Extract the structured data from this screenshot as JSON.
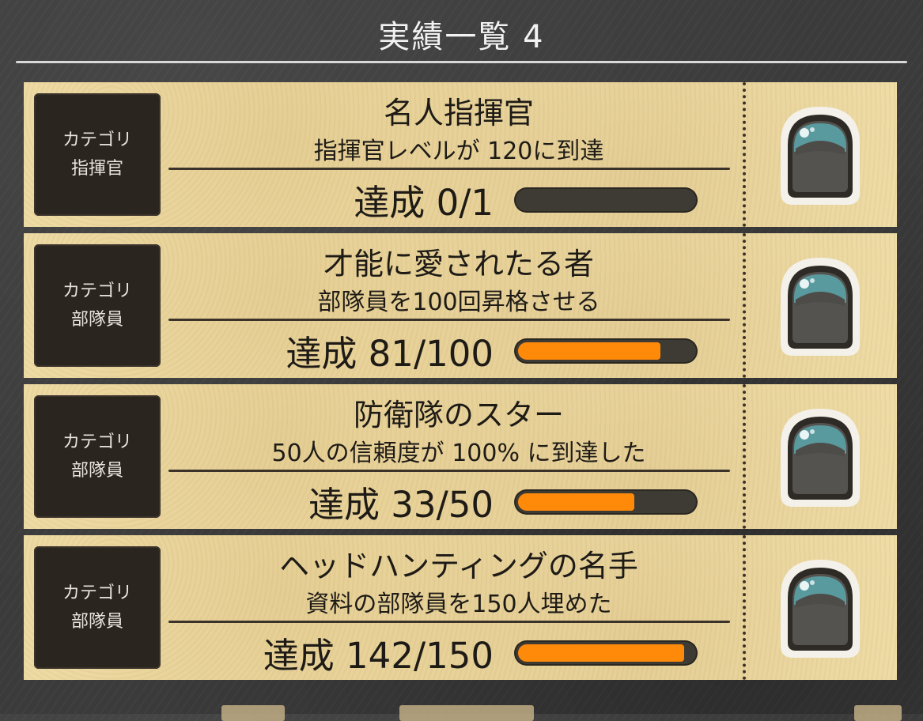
{
  "header": {
    "title": "実績一覧 4"
  },
  "progress_prefix": "達成",
  "achievements": [
    {
      "category_label": "カテゴリ",
      "category": "指揮官",
      "title": "名人指揮官",
      "description": "指揮官レベルが 120に到達",
      "progress_text": "達成 0/1",
      "current": 0,
      "target": 1
    },
    {
      "category_label": "カテゴリ",
      "category": "部隊員",
      "title": "才能に愛されたる者",
      "description": "部隊員を100回昇格させる",
      "progress_text": "達成 81/100",
      "current": 81,
      "target": 100
    },
    {
      "category_label": "カテゴリ",
      "category": "部隊員",
      "title": "防衛隊のスター",
      "description": "50人の信頼度が 100% に到達した",
      "progress_text": "達成 33/50",
      "current": 33,
      "target": 50
    },
    {
      "category_label": "カテゴリ",
      "category": "部隊員",
      "title": "ヘッドハンティングの名手",
      "description": "資料の部隊員を150人埋めた",
      "progress_text": "達成 142/150",
      "current": 142,
      "target": 150
    }
  ],
  "colors": {
    "paper": "#efdca6",
    "progress_fill": "#ff8a0a",
    "progress_track": "#3e3b34",
    "category_box": "#2b2520",
    "background": "#3b3b3b"
  },
  "icons": {
    "reward": "locked-reward-icon"
  }
}
